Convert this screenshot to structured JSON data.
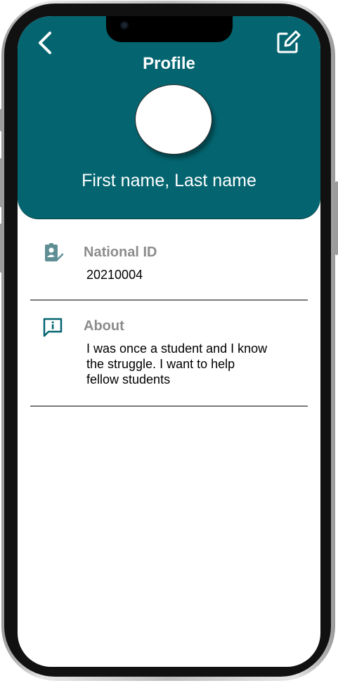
{
  "header": {
    "title": "Profile",
    "user_name": "First name, Last name",
    "back_icon": "chevron-left-icon",
    "edit_icon": "edit-square-icon",
    "background_color": "#046570"
  },
  "details": [
    {
      "icon": "id-badge-check-icon",
      "label": "National ID",
      "value": "20210004"
    },
    {
      "icon": "chat-info-icon",
      "label": "About",
      "value": "I was once a student and I know the struggle. I want to help fellow students"
    }
  ],
  "colors": {
    "accent": "#046570",
    "label_gray": "#8c8c8c",
    "icon_muted": "#5f8f95"
  }
}
